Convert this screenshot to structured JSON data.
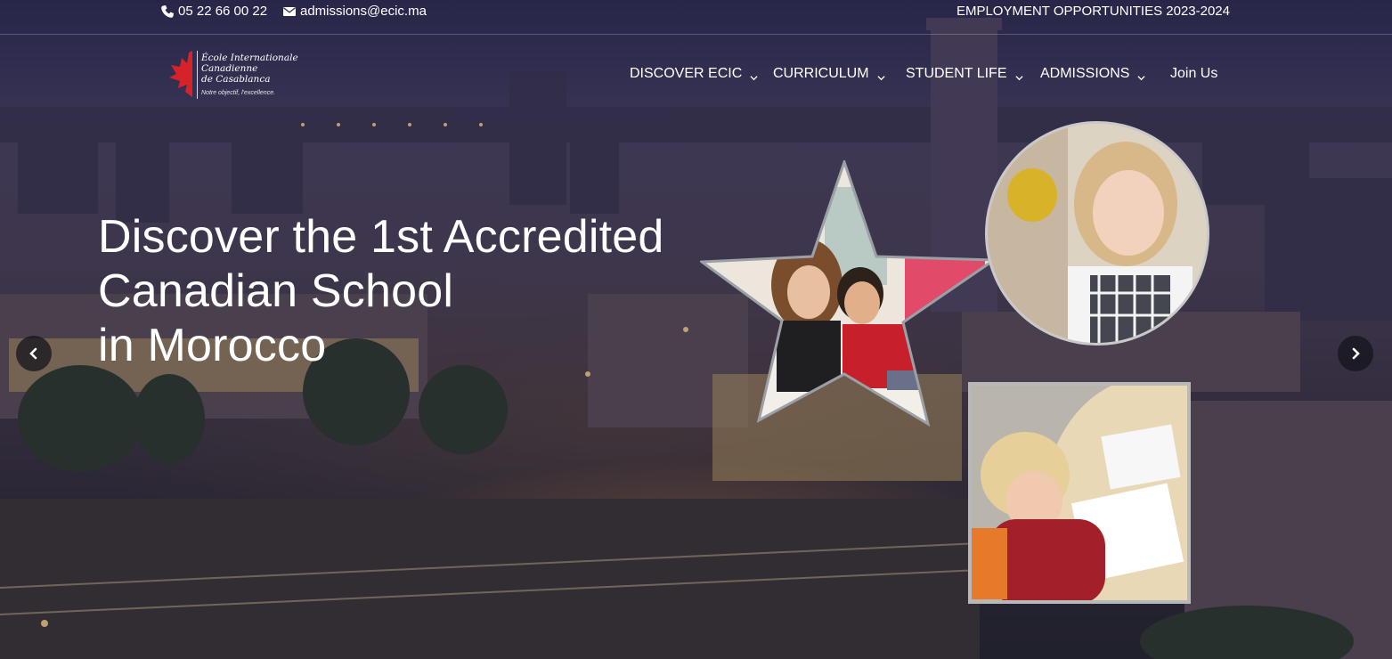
{
  "topbar": {
    "phone": "05 22 66 00 22",
    "email": "admissions@ecic.ma",
    "employment": "EMPLOYMENT OPPORTUNITIES 2023-2024"
  },
  "logo": {
    "line1": "École Internationale",
    "line2": "Canadienne",
    "line3": "de Casablanca",
    "tagline": "Notre objectif, l'excellence."
  },
  "nav": {
    "items": [
      {
        "label": "DISCOVER ECIC",
        "dropdown": true
      },
      {
        "label": "CURRICULUM",
        "dropdown": true
      },
      {
        "label": "STUDENT LIFE",
        "dropdown": true
      },
      {
        "label": "ADMISSIONS",
        "dropdown": true
      },
      {
        "label": "Join Us",
        "dropdown": false
      }
    ]
  },
  "hero": {
    "headline_lines": [
      "Discover the 1st Accredited",
      "Canadian School",
      "in Morocco"
    ]
  },
  "icons": {
    "phone": "phone-icon",
    "email": "envelope-icon",
    "prev": "chevron-left-icon",
    "next": "chevron-right-icon",
    "logo_leaf": "maple-leaf-icon"
  },
  "colors": {
    "text": "#ffffff",
    "maple_red": "#d6232a",
    "arrow_bg": "#14141c"
  }
}
